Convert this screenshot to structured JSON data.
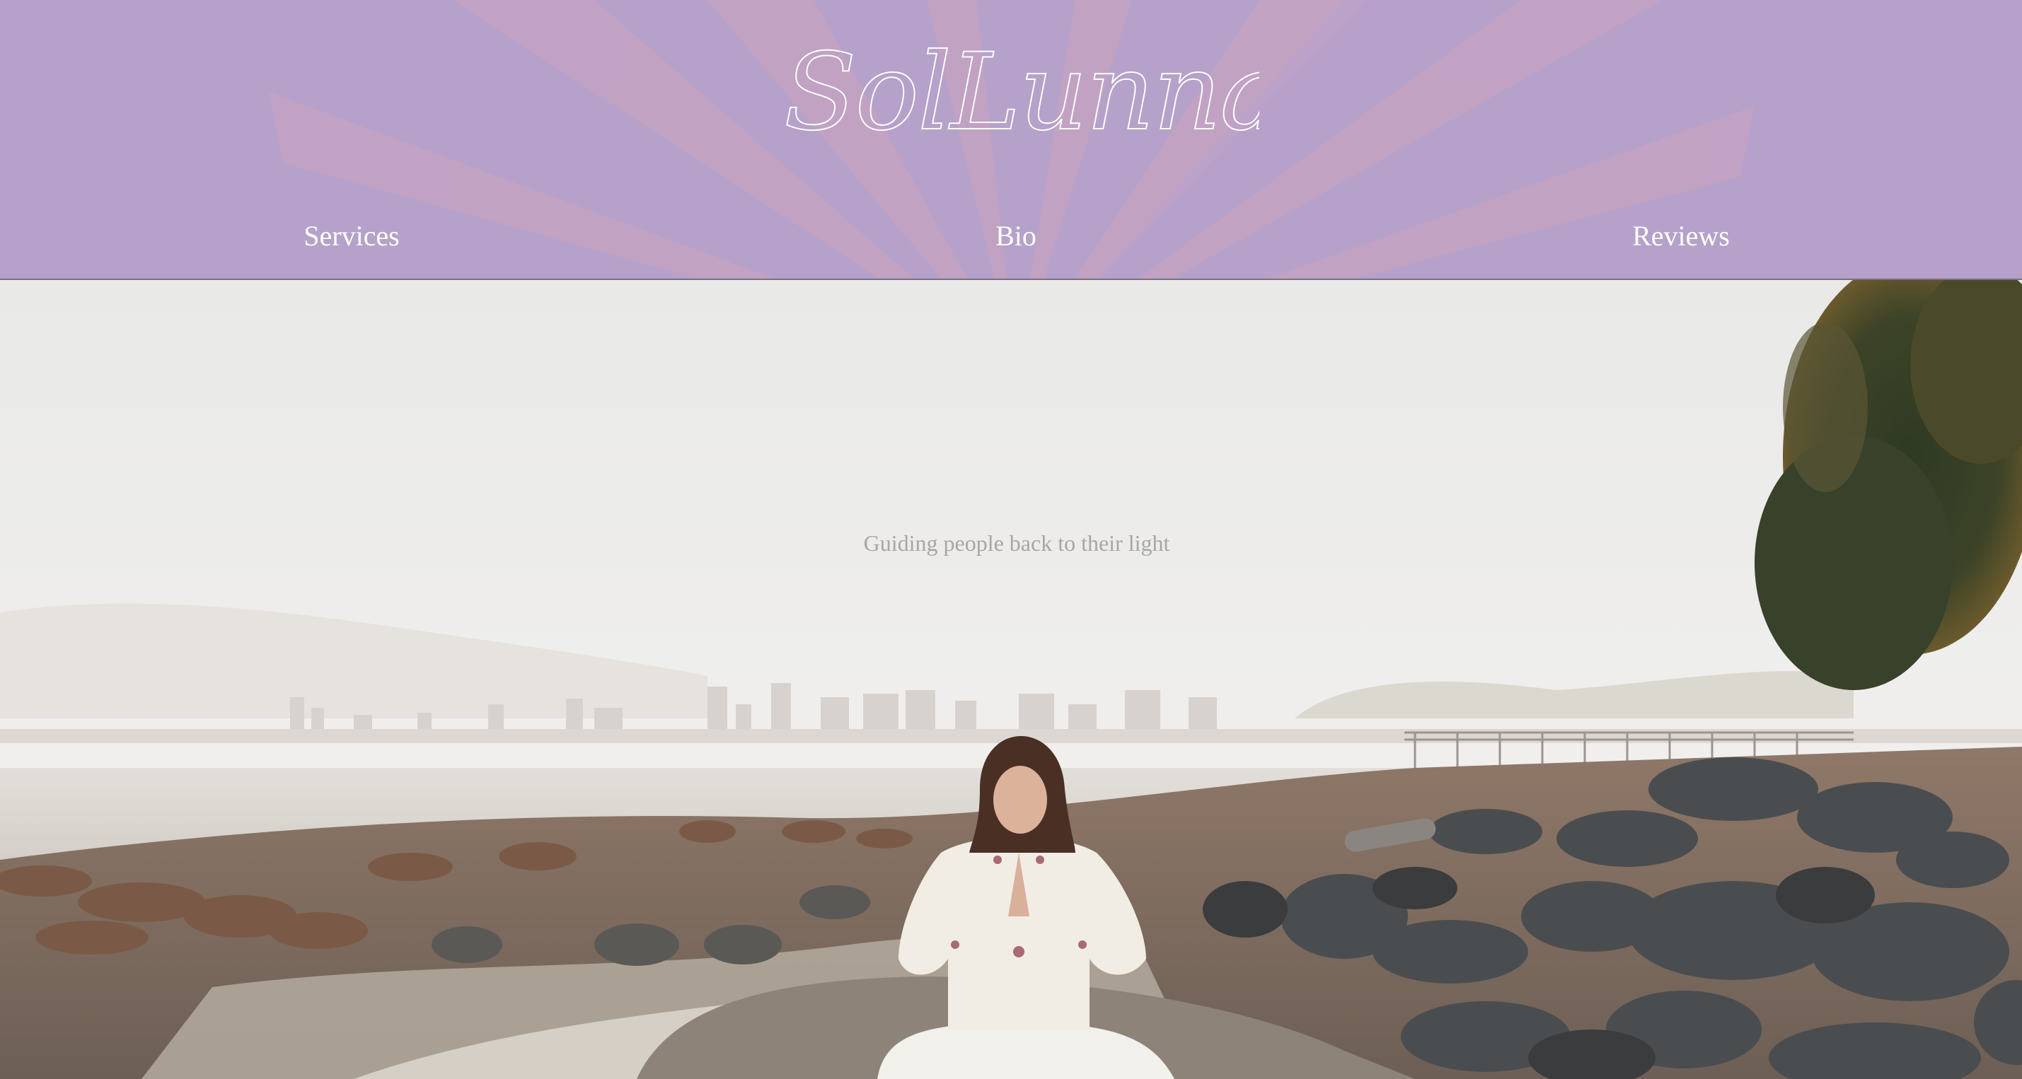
{
  "header": {
    "brand": "SolLunna Essence",
    "background_color": "#b5a1c9",
    "ray_color": "#c9a2bf",
    "nav": [
      {
        "label": "Services"
      },
      {
        "label": "Bio"
      },
      {
        "label": "Reviews"
      }
    ]
  },
  "hero": {
    "tagline": "Guiding people back to their light",
    "image": "woman-meditating-on-rocky-shore"
  }
}
